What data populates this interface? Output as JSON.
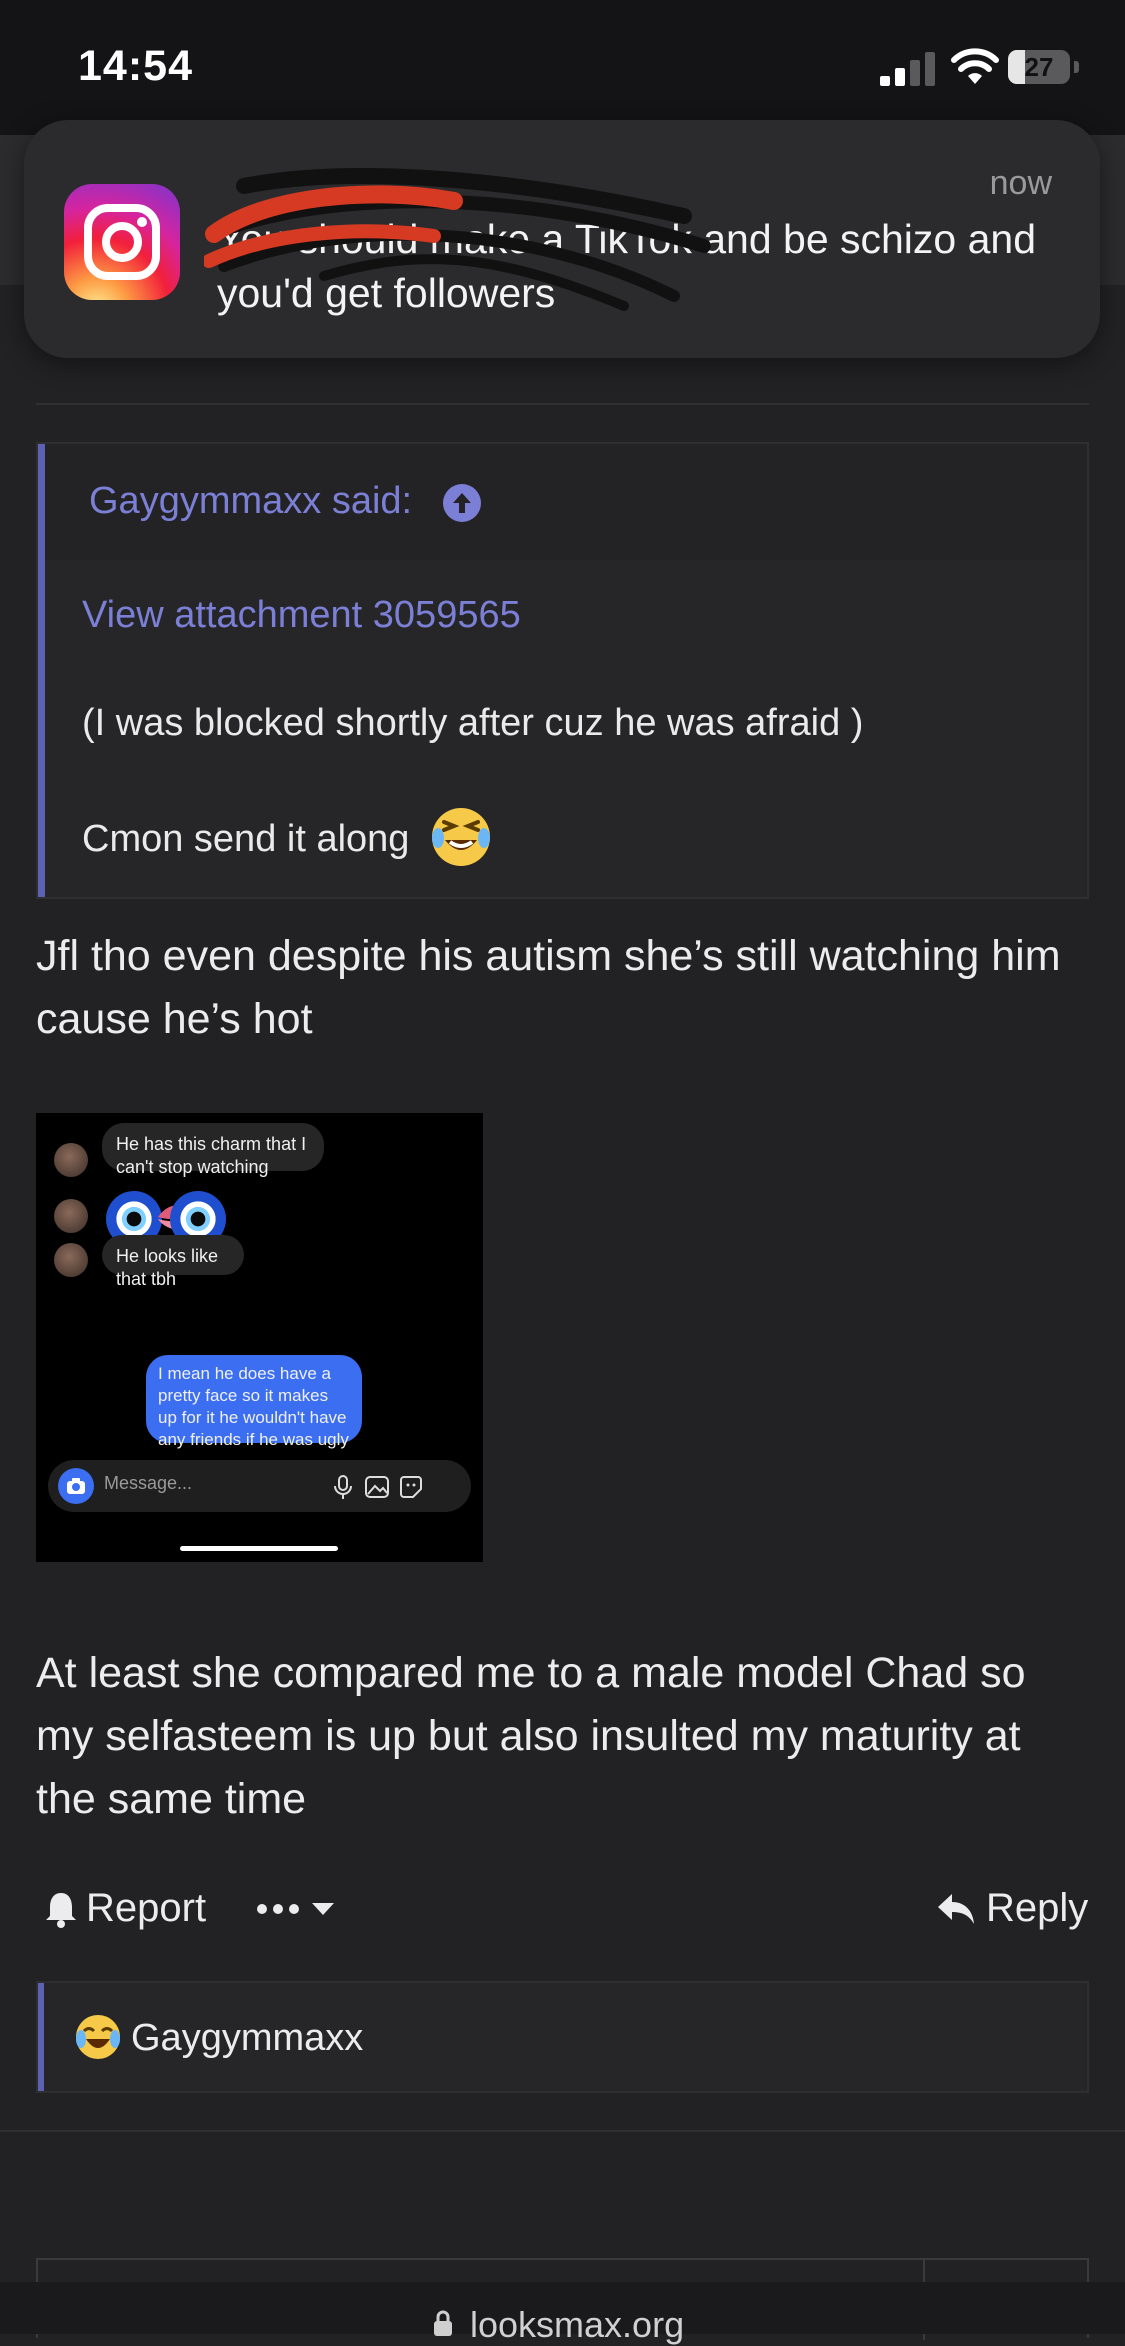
{
  "status_bar": {
    "time": "14:54",
    "battery": "27",
    "battery_level": 0.27
  },
  "notification": {
    "app_icon": "instagram-icon",
    "sender": "",
    "time": "now",
    "message": "You should make a TikTok and be schizo and you'd get followers"
  },
  "post": {
    "quote": {
      "author": "Gaygymmaxx said:",
      "attachment_link": "View attachment 3059565",
      "line1": "(I was blocked shortly after cuz he was afraid )",
      "line2": "Cmon send it along"
    },
    "paragraph1": "Jfl tho even despite his autism she’s still watching him cause he’s hot",
    "screenshot": {
      "messages": [
        "He has this charm that I can't stop watching",
        "He looks like that tbh",
        "I mean he does have a pretty face so it makes up for it he wouldn't have any friends if he was ugly"
      ],
      "composer_placeholder": "Message..."
    },
    "paragraph2": "At least she compared me to a male model Chad so my selfasteem is up but also insulted my maturity at the same time",
    "actions": {
      "report": "Report",
      "reply": "Reply"
    },
    "reaction": {
      "user": "Gaygymmaxx"
    }
  },
  "browser": {
    "url": "looksmax.org"
  },
  "colors": {
    "background": "#222224",
    "accent": "#5d61b3",
    "link": "#7b80d6",
    "bubble_mine": "#3b6ef0"
  }
}
